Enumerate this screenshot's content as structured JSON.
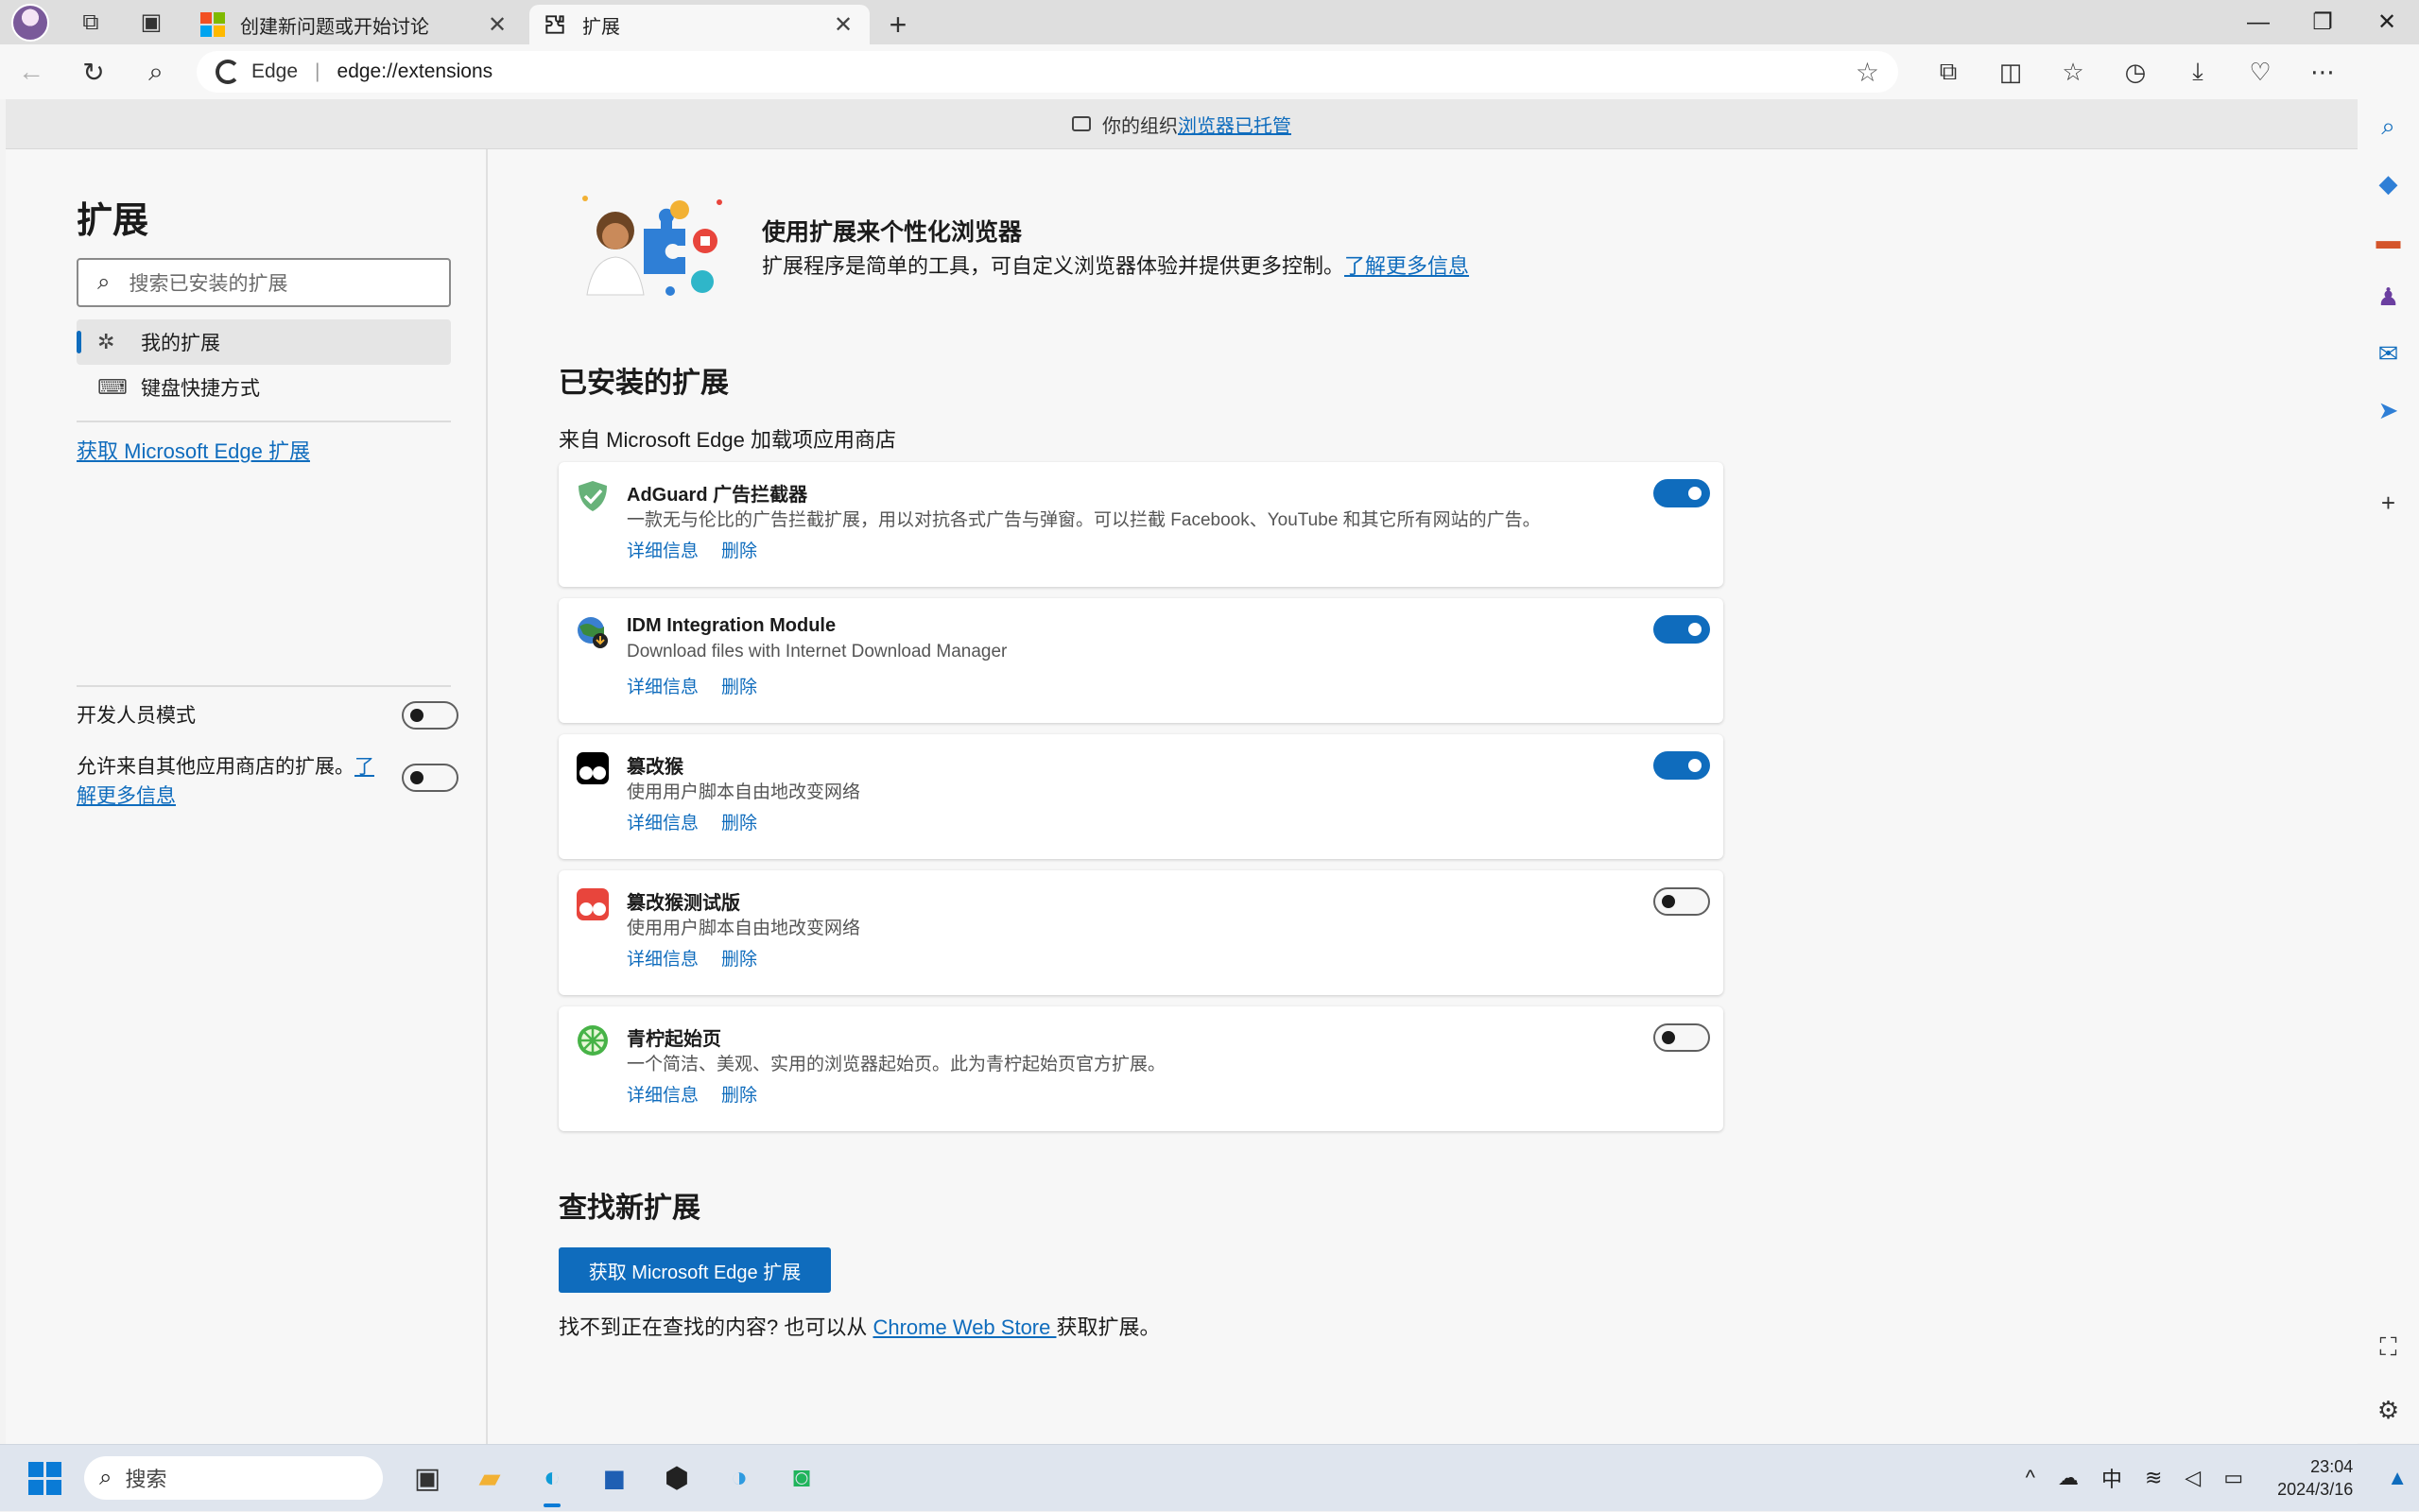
{
  "tabs": [
    {
      "title": "创建新问题或开始讨论",
      "active": false,
      "favicon": "microsoft-logo"
    },
    {
      "title": "扩展",
      "active": true,
      "favicon": "puzzle-icon"
    }
  ],
  "address": {
    "site_label": "Edge",
    "url": "edge://extensions"
  },
  "banner": {
    "prefix": "你的组织",
    "link": "浏览器已托管"
  },
  "sidebar": {
    "title": "扩展",
    "search_placeholder": "搜索已安装的扩展",
    "items": [
      {
        "label": "我的扩展",
        "icon": "puzzle-icon",
        "selected": true
      },
      {
        "label": "键盘快捷方式",
        "icon": "keyboard-icon",
        "selected": false
      }
    ],
    "get_link": "获取 Microsoft Edge 扩展",
    "dev_mode_label": "开发人员模式",
    "dev_mode_on": false,
    "other_stores_label": "允许来自其他应用商店的扩展。",
    "other_stores_link": "了解更多信息",
    "other_stores_on": false
  },
  "hero": {
    "title": "使用扩展来个性化浏览器",
    "desc": "扩展程序是简单的工具，可自定义浏览器体验并提供更多控制。",
    "link": "了解更多信息"
  },
  "installed": {
    "title": "已安装的扩展",
    "source": "来自 Microsoft Edge 加载项应用商店",
    "details_label": "详细信息",
    "remove_label": "删除",
    "items": [
      {
        "name": "AdGuard 广告拦截器",
        "desc": "一款无与伦比的广告拦截扩展，用以对抗各式广告与弹窗。可以拦截 Facebook、YouTube 和其它所有网站的广告。",
        "enabled": true,
        "icon": "shield-check-icon",
        "color": "#67b279"
      },
      {
        "name": "IDM Integration Module",
        "desc": "Download files with Internet Download Manager",
        "enabled": true,
        "icon": "idm-globe-icon",
        "color": "#3b8a3e"
      },
      {
        "name": "篡改猴",
        "desc": "使用用户脚本自由地改变网络",
        "enabled": true,
        "icon": "tampermonkey-icon",
        "color": "#000000"
      },
      {
        "name": "篡改猴测试版",
        "desc": "使用用户脚本自由地改变网络",
        "enabled": false,
        "icon": "tampermonkey-beta-icon",
        "color": "#e8453c"
      },
      {
        "name": "青柠起始页",
        "desc": "一个简洁、美观、实用的浏览器起始页。此为青柠起始页官方扩展。",
        "enabled": false,
        "icon": "lime-icon",
        "color": "#47b347"
      }
    ]
  },
  "find": {
    "title": "查找新扩展",
    "button": "获取 Microsoft Edge 扩展",
    "footer_prefix": "找不到正在查找的内容? 也可以从 ",
    "footer_link": "Chrome Web Store ",
    "footer_suffix": "获取扩展。"
  },
  "taskbar": {
    "search_placeholder": "搜索",
    "ime": "中",
    "time": "23:04",
    "date": "2024/3/16"
  },
  "colors": {
    "accent": "#0f6cbd"
  }
}
